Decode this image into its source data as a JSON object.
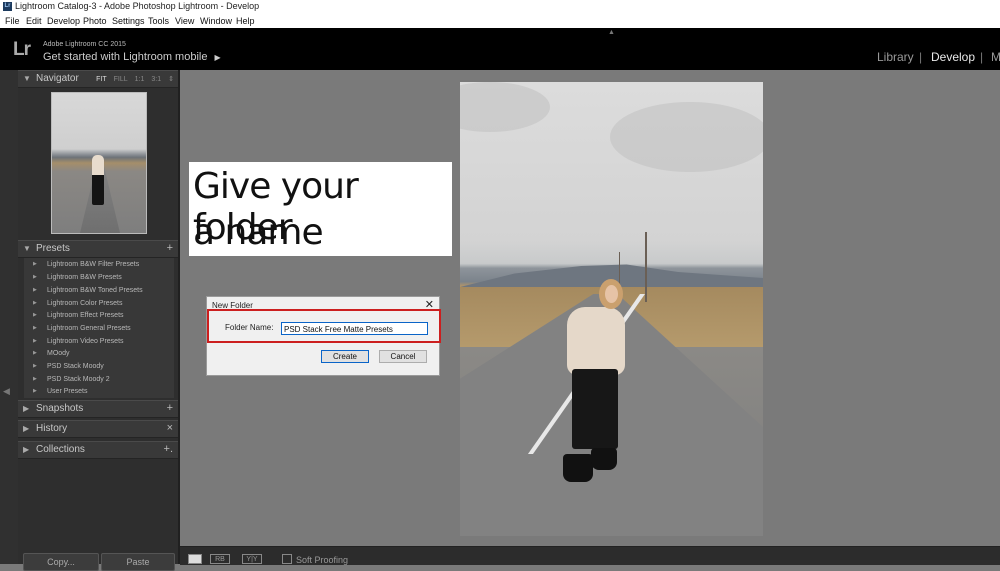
{
  "window": {
    "title": "Lightroom Catalog-3 - Adobe Photoshop Lightroom - Develop",
    "logo_text": "Lr",
    "controls": {
      "minimize": "–",
      "maximize": "☐",
      "close": "✕"
    }
  },
  "menu": [
    "File",
    "Edit",
    "Develop",
    "Photo",
    "Settings",
    "Tools",
    "View",
    "Window",
    "Help"
  ],
  "identity": {
    "logo": "Lr",
    "version": "Adobe Lightroom CC 2015",
    "mobile_label": "Get started with Lightroom mobile",
    "mobile_arrow": "▶",
    "modules": [
      "Library",
      "Develop",
      "M"
    ],
    "active_module": "Develop"
  },
  "left_panel": {
    "navigator": {
      "title": "Navigator",
      "zoom_options": [
        "FIT",
        "FILL",
        "1:1",
        "3:1",
        "⇕"
      ],
      "active_zoom": "FIT"
    },
    "presets": {
      "title": "Presets",
      "add": "+",
      "items": [
        "Lightroom B&W Filter Presets",
        "Lightroom B&W Presets",
        "Lightroom B&W Toned Presets",
        "Lightroom Color Presets",
        "Lightroom Effect Presets",
        "Lightroom General Presets",
        "Lightroom Video Presets",
        "MOody",
        "PSD Stack Moody",
        "PSD Stack Moody 2",
        "User Presets"
      ]
    },
    "snapshots": {
      "title": "Snapshots",
      "action": "+"
    },
    "history": {
      "title": "History",
      "action": "×"
    },
    "collections": {
      "title": "Collections",
      "action": "+."
    },
    "copy_label": "Copy...",
    "paste_label": "Paste"
  },
  "callout": {
    "line1": "Give your folder",
    "line2": "a name"
  },
  "dialog": {
    "title": "New Folder",
    "close": "✕",
    "field_label": "Folder Name:",
    "field_value": "PSD Stack Free Matte Presets",
    "create_label": "Create",
    "cancel_label": "Cancel",
    "highlight_color": "#cc1f1f"
  },
  "toolbar": {
    "view_modes": [
      "",
      "RB",
      "Y|Y"
    ],
    "soft_proofing_label": "Soft Proofing"
  },
  "glyphs": {
    "triangle_down": "▼",
    "triangle_right": "▶",
    "small_right": "▸",
    "collapse_up": "▲",
    "collapse_left": "◀"
  }
}
